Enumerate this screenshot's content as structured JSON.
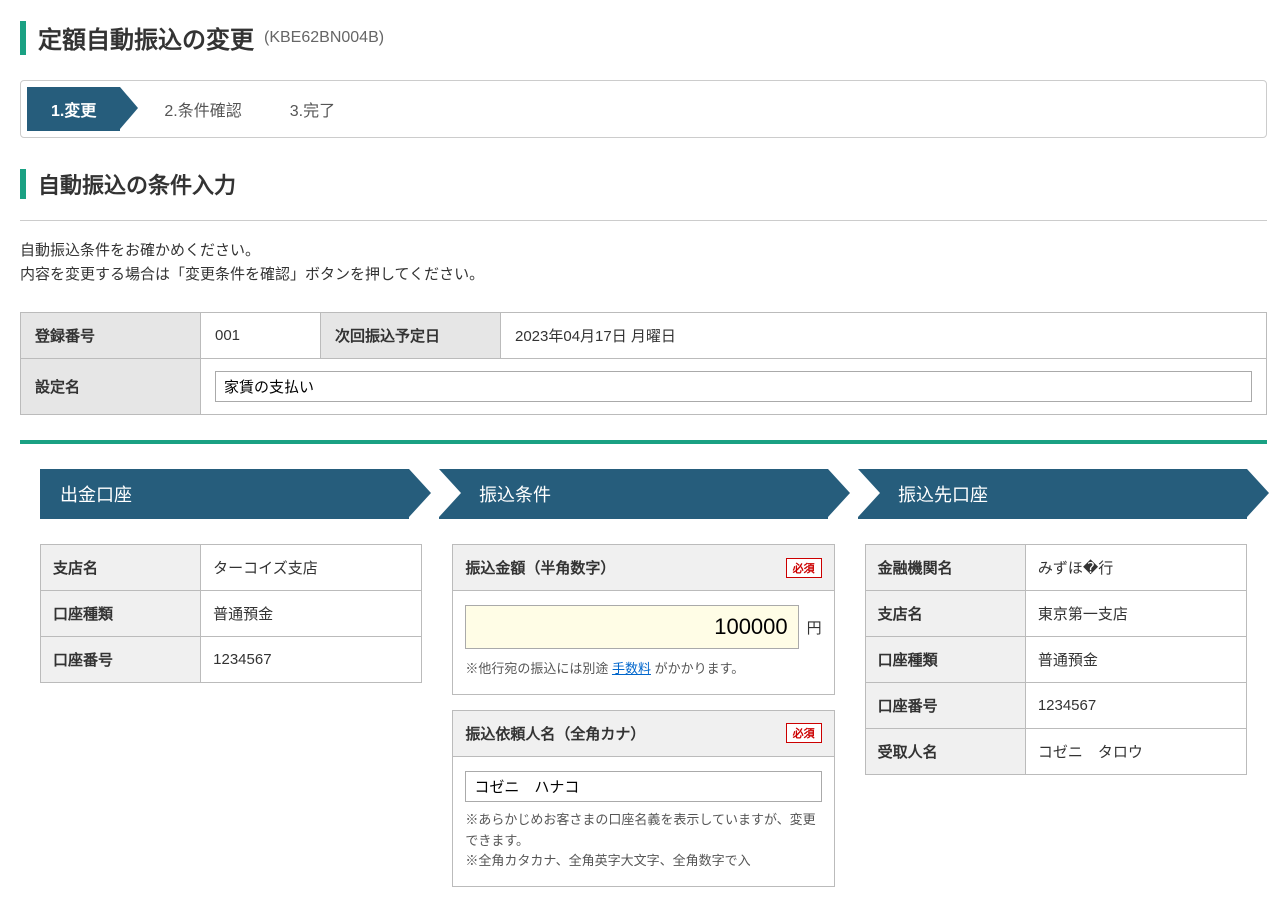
{
  "header": {
    "title": "定額自動振込の変更",
    "code": "(KBE62BN004B)"
  },
  "steps": {
    "s1": "1.変更",
    "s2": "2.条件確認",
    "s3": "3.完了"
  },
  "section": {
    "title": "自動振込の条件入力",
    "intro1": "自動振込条件をお確かめください。",
    "intro2": "内容を変更する場合は「変更条件を確認」ボタンを押してください。"
  },
  "info": {
    "reg_no_label": "登録番号",
    "reg_no": "001",
    "next_date_label": "次回振込予定日",
    "next_date": "2023年04月17日 月曜日",
    "setting_name_label": "設定名",
    "setting_name": "家賃の支払い"
  },
  "arrows": {
    "a1": "出金口座",
    "a2": "振込条件",
    "a3": "振込先口座"
  },
  "withdraw": {
    "branch_label": "支店名",
    "branch": "ターコイズ支店",
    "type_label": "口座種類",
    "type": "普通預金",
    "number_label": "口座番号",
    "number": "1234567"
  },
  "conditions": {
    "amount_label": "振込金額（半角数字）",
    "required": "必須",
    "amount": "100000",
    "yen": "円",
    "amount_note_prefix": "※他行宛の振込には別途 ",
    "fee_link": "手数料",
    "amount_note_suffix": " がかかります。",
    "name_label": "振込依頼人名（全角カナ）",
    "name": "コゼニ　ハナコ",
    "name_note1": "※あらかじめお客さまの口座名義を表示していますが、変更できます。",
    "name_note2": "※全角カタカナ、全角英字大文字、全角数字で入"
  },
  "destination": {
    "bank_label": "金融機関名",
    "bank": "みずほ�行",
    "branch_label": "支店名",
    "branch": "東京第一支店",
    "type_label": "口座種類",
    "type": "普通預金",
    "number_label": "口座番号",
    "number": "1234567",
    "recipient_label": "受取人名",
    "recipient": "コゼニ　タロウ"
  }
}
